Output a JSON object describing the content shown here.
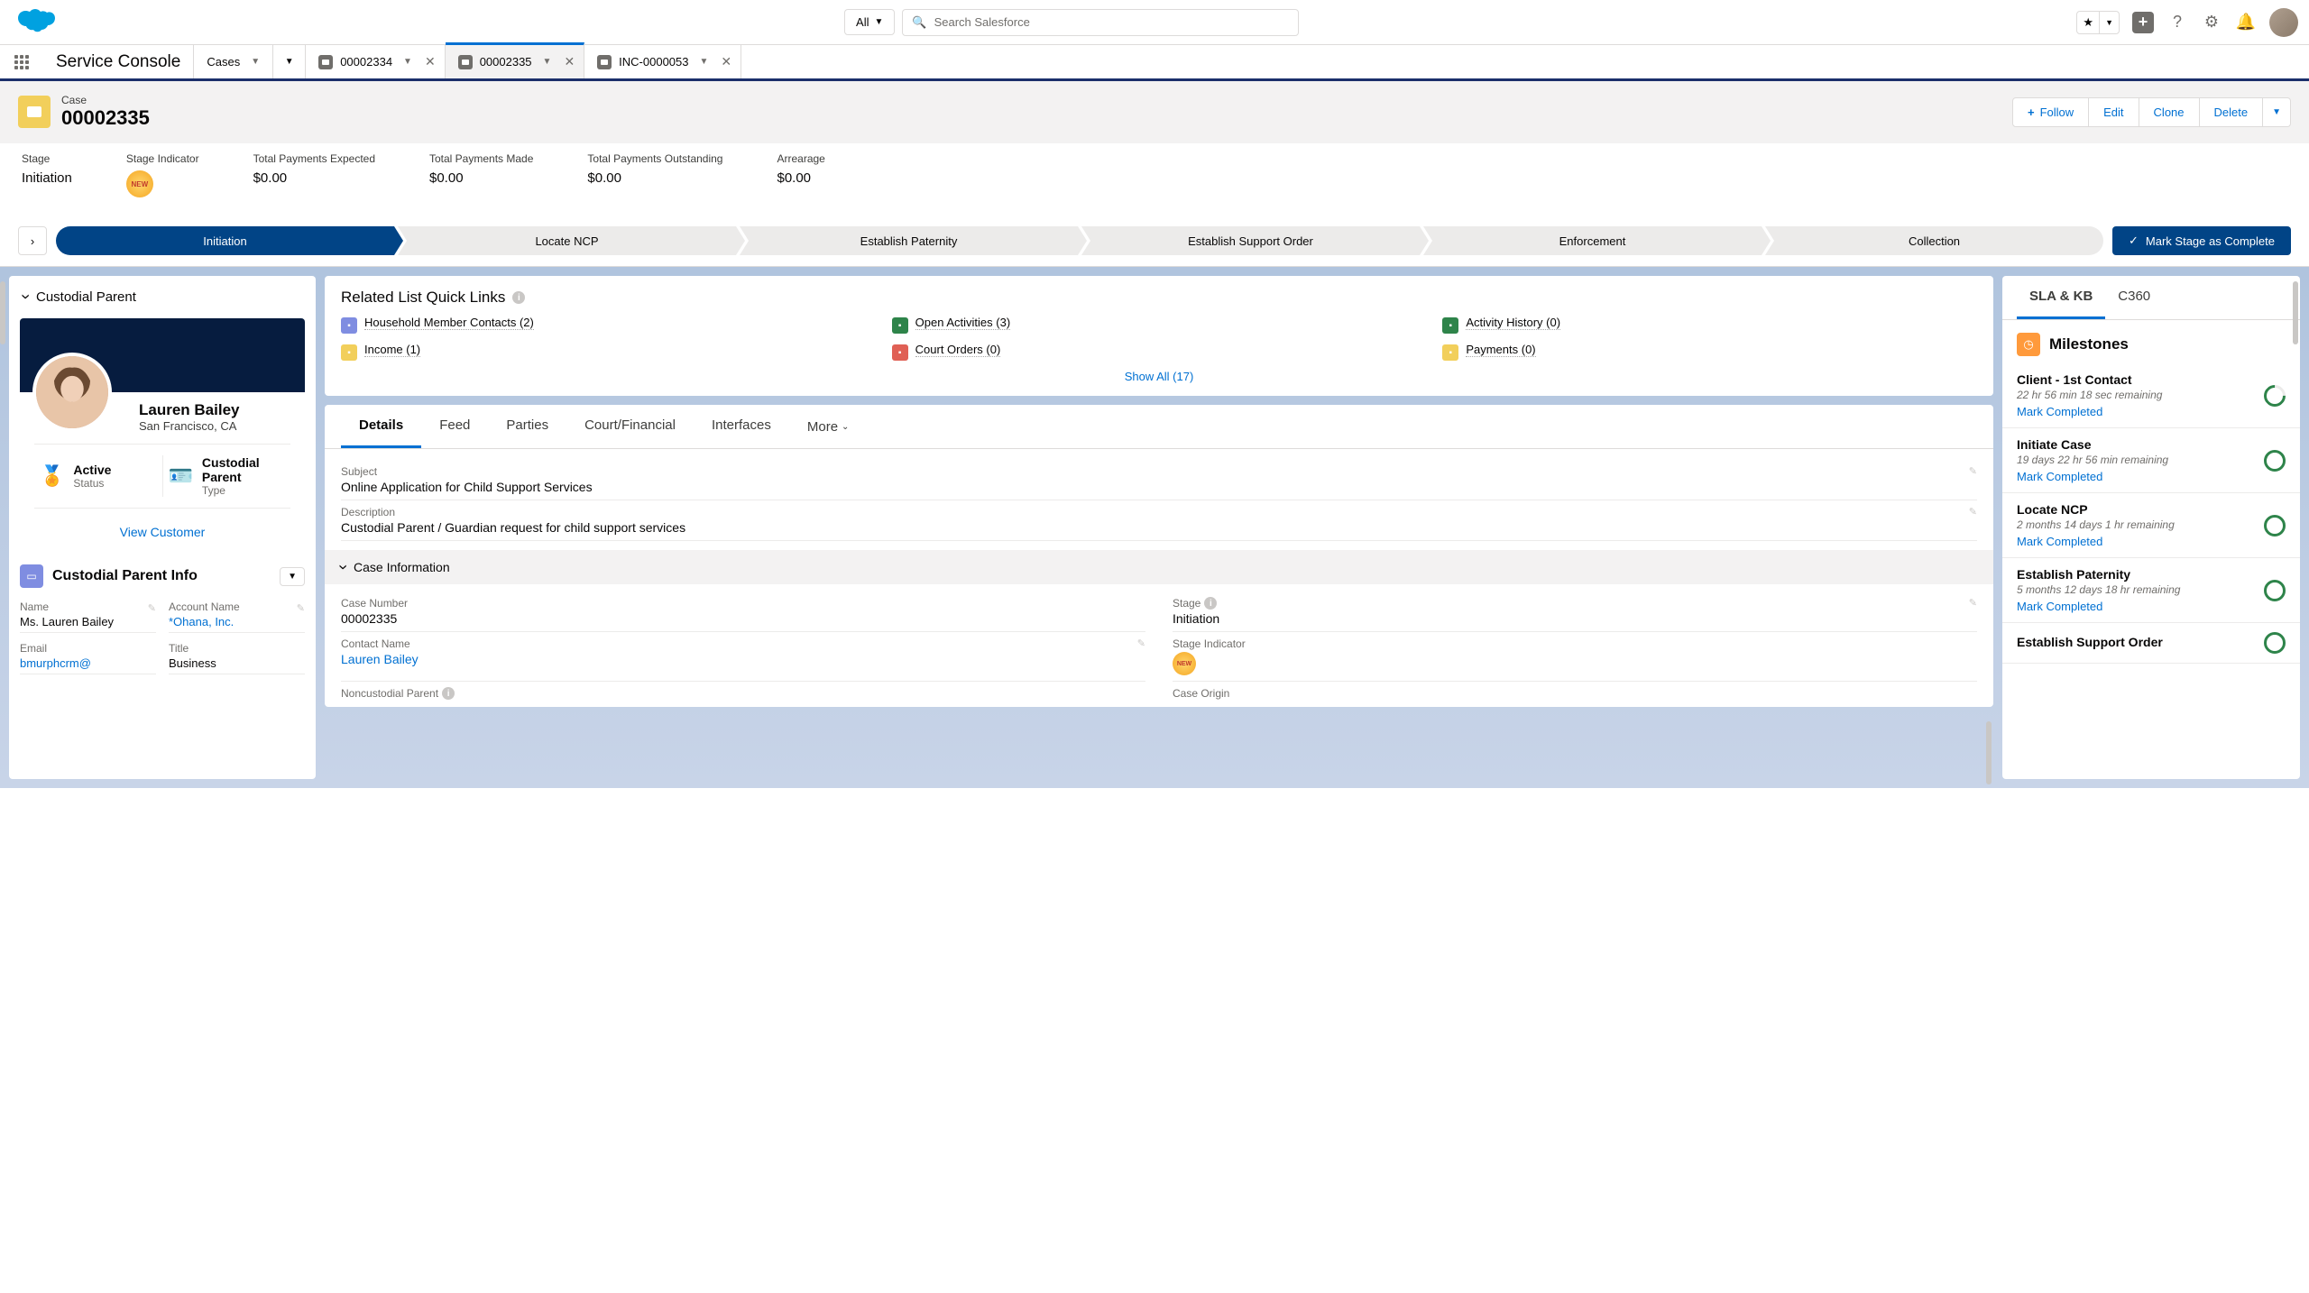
{
  "globalSearch": {
    "scope": "All",
    "placeholder": "Search Salesforce"
  },
  "appBar": {
    "appName": "Service Console",
    "navItems": [
      {
        "label": "Cases"
      }
    ],
    "workspaceTabs": [
      {
        "label": "00002334",
        "active": false
      },
      {
        "label": "00002335",
        "active": true
      },
      {
        "label": "INC-0000053",
        "active": false
      }
    ]
  },
  "recordHeader": {
    "objectLabel": "Case",
    "title": "00002335",
    "actions": {
      "follow": "Follow",
      "edit": "Edit",
      "clone": "Clone",
      "delete": "Delete"
    }
  },
  "highlights": {
    "stage": {
      "label": "Stage",
      "value": "Initiation"
    },
    "stageIndicator": {
      "label": "Stage Indicator",
      "badge": "NEW"
    },
    "expected": {
      "label": "Total Payments Expected",
      "value": "$0.00"
    },
    "made": {
      "label": "Total Payments Made",
      "value": "$0.00"
    },
    "outstanding": {
      "label": "Total Payments Outstanding",
      "value": "$0.00"
    },
    "arrearage": {
      "label": "Arrearage",
      "value": "$0.00"
    }
  },
  "path": {
    "steps": [
      "Initiation",
      "Locate NCP",
      "Establish Paternity",
      "Establish Support Order",
      "Enforcement",
      "Collection"
    ],
    "activeIndex": 0,
    "completeLabel": "Mark Stage as Complete"
  },
  "leftPanel": {
    "accordionTitle": "Custodial Parent",
    "contact": {
      "name": "Lauren Bailey",
      "location": "San Francisco, CA",
      "status": {
        "value": "Active",
        "label": "Status"
      },
      "type": {
        "value": "Custodial Parent",
        "label": "Type"
      },
      "viewLink": "View Customer"
    },
    "infoCard": {
      "title": "Custodial Parent Info",
      "fields": {
        "name": {
          "label": "Name",
          "value": "Ms. Lauren Bailey"
        },
        "account": {
          "label": "Account Name",
          "value": "*Ohana, Inc."
        },
        "email": {
          "label": "Email",
          "value": "bmurphcrm@"
        },
        "title": {
          "label": "Title",
          "value": "Business"
        }
      }
    }
  },
  "midPanel": {
    "quickLinks": {
      "title": "Related List Quick Links",
      "items": [
        {
          "label": "Household Member Contacts (2)",
          "color": "#7f8de1"
        },
        {
          "label": "Open Activities (3)",
          "color": "#2e844a"
        },
        {
          "label": "Activity History (0)",
          "color": "#2e844a"
        },
        {
          "label": "Income (1)",
          "color": "#f2cf5b"
        },
        {
          "label": "Court Orders (0)",
          "color": "#e06055"
        },
        {
          "label": "Payments (0)",
          "color": "#f2cf5b"
        }
      ],
      "showAll": "Show All (17)"
    },
    "tabs": [
      "Details",
      "Feed",
      "Parties",
      "Court/Financial",
      "Interfaces",
      "More"
    ],
    "details": {
      "subject": {
        "label": "Subject",
        "value": "Online Application for Child Support Services"
      },
      "description": {
        "label": "Description",
        "value": "Custodial Parent / Guardian request for child support services"
      },
      "sectionTitle": "Case Information",
      "caseNumber": {
        "label": "Case Number",
        "value": "00002335"
      },
      "stage": {
        "label": "Stage",
        "value": "Initiation"
      },
      "contactName": {
        "label": "Contact Name",
        "value": "Lauren Bailey"
      },
      "stageIndicator": {
        "label": "Stage Indicator",
        "badge": "NEW"
      },
      "noncustodial": {
        "label": "Noncustodial Parent"
      },
      "origin": {
        "label": "Case Origin"
      }
    }
  },
  "rightPanel": {
    "tabs": [
      "SLA & KB",
      "C360"
    ],
    "milestonesTitle": "Milestones",
    "milestones": [
      {
        "name": "Client - 1st Contact",
        "remaining": "22 hr 56 min 18 sec remaining",
        "mark": "Mark Completed",
        "partial": true
      },
      {
        "name": "Initiate Case",
        "remaining": "19 days 22 hr 56 min remaining",
        "mark": "Mark Completed",
        "partial": false
      },
      {
        "name": "Locate NCP",
        "remaining": "2 months 14 days 1 hr remaining",
        "mark": "Mark Completed",
        "partial": false
      },
      {
        "name": "Establish Paternity",
        "remaining": "5 months 12 days 18 hr remaining",
        "mark": "Mark Completed",
        "partial": false
      },
      {
        "name": "Establish Support Order",
        "remaining": "",
        "mark": "",
        "partial": false
      }
    ]
  }
}
